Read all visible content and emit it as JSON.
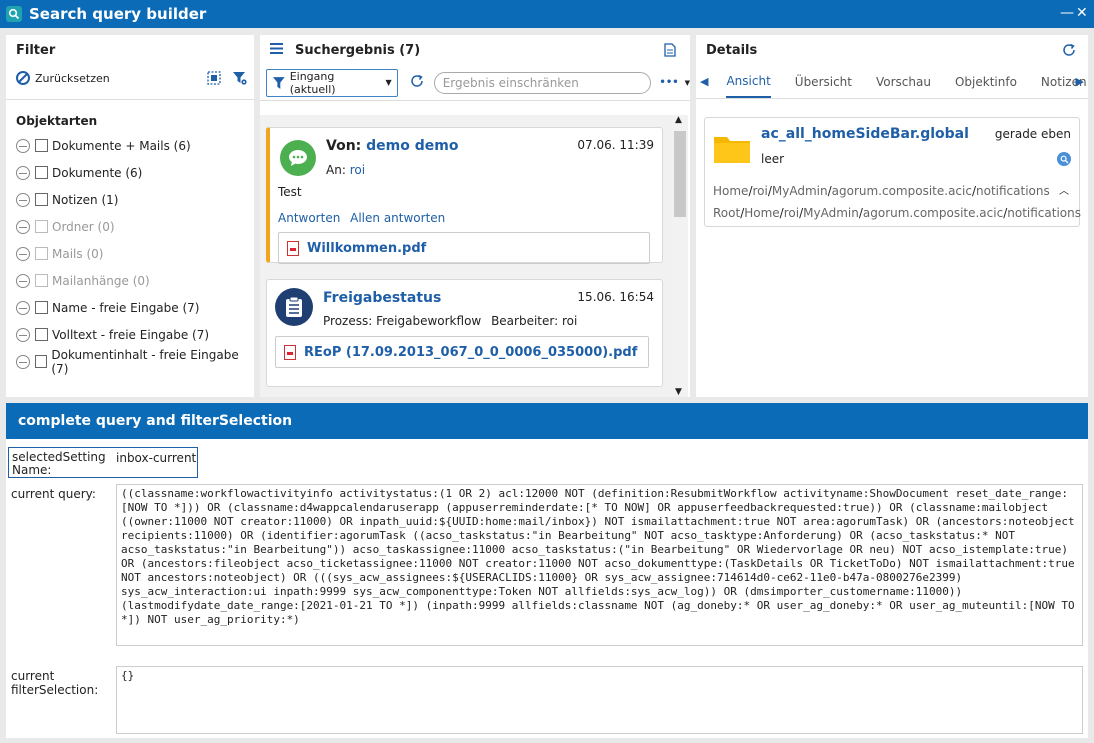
{
  "window": {
    "title": "Search query builder",
    "controls": [
      "—",
      "✕"
    ]
  },
  "filter": {
    "title": "Filter",
    "reset_label": "Zurücksetzen",
    "section": "Objektarten",
    "items": [
      {
        "label": "Dokumente + Mails (6)",
        "enabled": true
      },
      {
        "label": "Dokumente (6)",
        "enabled": true
      },
      {
        "label": "Notizen (1)",
        "enabled": true
      },
      {
        "label": "Ordner (0)",
        "enabled": false
      },
      {
        "label": "Mails (0)",
        "enabled": false
      },
      {
        "label": "Mailanhänge (0)",
        "enabled": false
      },
      {
        "label": "Name - freie Eingabe (7)",
        "enabled": true
      },
      {
        "label": "Volltext - freie Eingabe (7)",
        "enabled": true
      },
      {
        "label": "Dokumentinhalt - freie Eingabe (7)",
        "enabled": true
      }
    ]
  },
  "results": {
    "title": "Suchergebnis (7)",
    "dropdown_label": "Eingang (aktuell)",
    "search_placeholder": "Ergebnis einschränken",
    "more_label": "•••",
    "cards": [
      {
        "from_label": "Von:",
        "from_name": "demo demo",
        "time": "07.06. 11:39",
        "to_label": "An:",
        "to_name": "roi",
        "body": "Test",
        "action_reply": "Antworten",
        "action_reply_all": "Allen antworten",
        "attachment": "Willkommen.pdf"
      },
      {
        "title": "Freigabestatus",
        "time": "15.06. 16:54",
        "process_label": "Prozess: Freigabeworkflow",
        "assignee_label": "Bearbeiter: roi",
        "attachment": "REoP (17.09.2013_067_0_0_0006_035000).pdf"
      }
    ]
  },
  "details": {
    "title": "Details",
    "tabs": [
      "Ansicht",
      "Übersicht",
      "Vorschau",
      "Objektinfo",
      "Notizen"
    ],
    "active_tab": "Ansicht",
    "item_name": "ac_all_homeSideBar.global",
    "item_time": "gerade eben",
    "item_sub": "leer",
    "path1": [
      "Home",
      "roi",
      "MyAdmin",
      "agorum.composite.acic",
      "notifications"
    ],
    "path2": [
      "Root",
      "Home",
      "roi",
      "MyAdmin",
      "agorum.composite.acic",
      "notifications"
    ]
  },
  "query": {
    "title": "complete query and filterSelection",
    "setting_label": "selectedSetting Name:",
    "setting_value": "inbox-current",
    "current_query_label": "current query:",
    "current_query": "((classname:workflowactivityinfo activitystatus:(1 OR 2) acl:12000 NOT (definition:ResubmitWorkflow activityname:ShowDocument reset_date_range:[NOW TO *])) OR (classname:d4wappcalendaruserapp (appuserreminderdate:[* TO NOW] OR appuserfeedbackrequested:true)) OR (classname:mailobject ((owner:11000 NOT creator:11000) OR inpath_uuid:${UUID:home:mail/inbox}) NOT ismailattachment:true NOT area:agorumTask) OR (ancestors:noteobject recipients:11000) OR (identifier:agorumTask ((acso_taskstatus:\"in Bearbeitung\" NOT acso_tasktype:Anforderung) OR (acso_taskstatus:* NOT acso_taskstatus:\"in Bearbeitung\")) acso_taskassignee:11000 acso_taskstatus:(\"in Bearbeitung\" OR Wiedervorlage OR neu) NOT acso_istemplate:true) OR (ancestors:fileobject acso_ticketassignee:11000 NOT creator:11000 NOT acso_dokumenttype:(TaskDetails OR TicketToDo) NOT ismailattachment:true NOT ancestors:noteobject) OR (((sys_acw_assignees:${USERACLIDS:11000} OR sys_acw_assignee:714614d0-ce62-11e0-b47a-0800276e2399) sys_acw_interaction:ui inpath:9999 sys_acw_componenttype:Token NOT allfields:sys_acw_log)) OR (dmsimporter_customername:11000)) (lastmodifydate_date_range:[2021-01-21 TO *]) (inpath:9999 allfields:classname NOT (ag_doneby:* OR user_ag_doneby:* OR user_ag_muteuntil:[NOW TO *]) NOT user_ag_priority:*)",
    "filter_selection_label": "current filterSelection:",
    "filter_selection": "{}"
  }
}
